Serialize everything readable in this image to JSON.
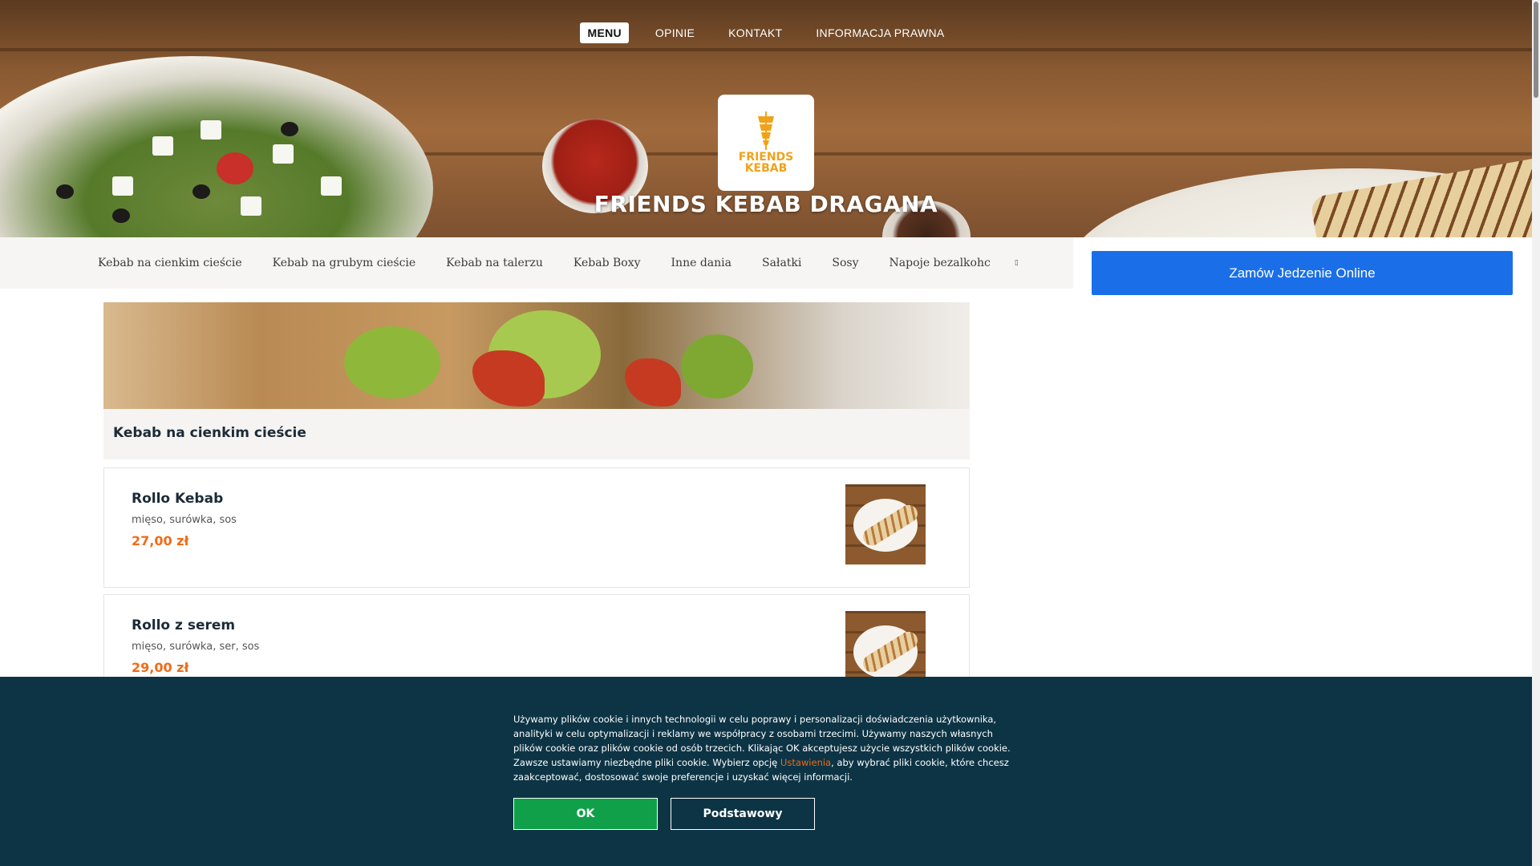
{
  "nav": {
    "items": [
      {
        "label": "MENU",
        "active": true
      },
      {
        "label": "OPINIE",
        "active": false
      },
      {
        "label": "KONTAKT",
        "active": false
      },
      {
        "label": "INFORMACJA PRAWNA",
        "active": false
      }
    ]
  },
  "logo": {
    "line1": "FRIENDS",
    "line2": "KEBAB",
    "icon": "kebab-spit-icon",
    "color": "#f0a21a"
  },
  "restaurant_name": "FRIENDS KEBAB DRAGANA",
  "categories": [
    "Kebab na cienkim cieście",
    "Kebab na grubym cieście",
    "Kebab na talerzu",
    "Kebab Boxy",
    "Inne dania",
    "Sałatki",
    "Sosy",
    "Napoje bezalkohc"
  ],
  "categories_more_icon": "chevron-right-icon",
  "order_button": {
    "label": "Zamów Jedzenie Online",
    "color": "#1a6fe8"
  },
  "section": {
    "title": "Kebab na cienkim cieście",
    "items": [
      {
        "name": "Rollo Kebab",
        "desc": "mięso, surówka, sos",
        "price": "27,00 zł"
      },
      {
        "name": "Rollo z serem",
        "desc": "mięso, surówka, ser, sos",
        "price": "29,00 zł"
      }
    ]
  },
  "price_color": "#f26a16",
  "cookie": {
    "text_before": "Używamy plików cookie i innych technologii w celu poprawy i personalizacji doświadczenia użytkownika, analityki w celu optymalizacji i reklamy we współpracy z osobami trzecimi. Używamy naszych własnych plików cookie oraz plików cookie od osób trzecich. Klikając OK akceptujesz użycie wszystkich plików cookie. Zawsze ustawiamy niezbędne pliki cookie. Wybierz opcję ",
    "link": "Ustawienia",
    "text_after": ", aby wybrać pliki cookie, które chcesz zaakceptować, dostosować swoje preferencje i uzyskać więcej informacji.",
    "ok_label": "OK",
    "basic_label": "Podstawowy",
    "background": "#0d3445",
    "ok_color": "#10a04a"
  }
}
